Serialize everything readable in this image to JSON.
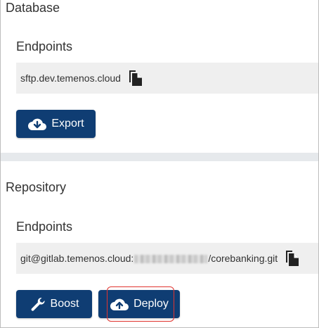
{
  "database": {
    "title": "Database",
    "endpoints_label": "Endpoints",
    "endpoint_value": "sftp.dev.temenos.cloud",
    "export_label": "Export"
  },
  "repository": {
    "title": "Repository",
    "endpoints_label": "Endpoints",
    "endpoint_prefix": "git@gitlab.temenos.cloud:",
    "endpoint_suffix": "/corebanking.git",
    "boost_label": "Boost",
    "deploy_label": "Deploy"
  },
  "colors": {
    "button": "#0f3d73",
    "panel": "#efefef",
    "separator": "#e6e9ec",
    "highlight": "#e0342f"
  },
  "icons": {
    "copy": "copy-icon",
    "cloud_download": "cloud-download-icon",
    "cloud_upload": "cloud-upload-icon",
    "wrench": "wrench-icon"
  }
}
